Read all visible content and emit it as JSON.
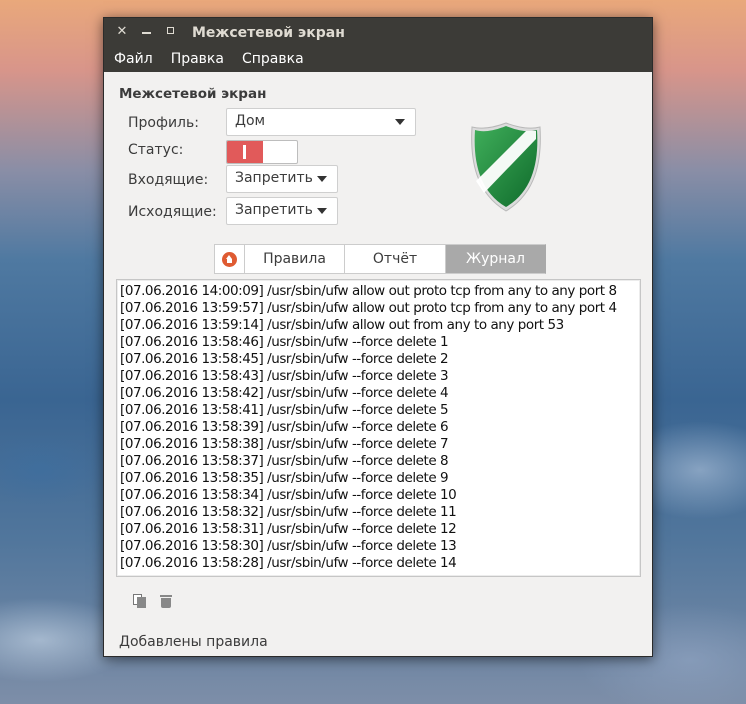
{
  "window": {
    "title": "Межсетевой экран"
  },
  "menu": [
    "Файл",
    "Правка",
    "Справка"
  ],
  "section_title": "Межсетевой экран",
  "form": {
    "profile_label": "Профиль:",
    "profile_value": "Дом",
    "status_label": "Статус:",
    "status_on": true,
    "incoming_label": "Входящие:",
    "incoming_value": "Запретить",
    "outgoing_label": "Исходящие:",
    "outgoing_value": "Запретить"
  },
  "colors": {
    "toggle_on": "#e15a5a",
    "active_tab": "#a9a9a9",
    "home_icon": "#df5b32",
    "shield_green": "#1f8a3a"
  },
  "tabs": {
    "home_icon": "home-icon",
    "rules": "Правила",
    "report": "Отчёт",
    "log": "Журнал",
    "active": "log"
  },
  "log_lines": [
    "[07.06.2016 14:00:09] /usr/sbin/ufw allow out proto tcp from any to any port 8",
    "[07.06.2016 13:59:57] /usr/sbin/ufw allow out proto tcp from any to any port 4",
    "[07.06.2016 13:59:14] /usr/sbin/ufw allow out from any to any port 53",
    "[07.06.2016 13:58:46] /usr/sbin/ufw --force delete 1",
    "[07.06.2016 13:58:45] /usr/sbin/ufw --force delete 2",
    "[07.06.2016 13:58:43] /usr/sbin/ufw --force delete 3",
    "[07.06.2016 13:58:42] /usr/sbin/ufw --force delete 4",
    "[07.06.2016 13:58:41] /usr/sbin/ufw --force delete 5",
    "[07.06.2016 13:58:39] /usr/sbin/ufw --force delete 6",
    "[07.06.2016 13:58:38] /usr/sbin/ufw --force delete 7",
    "[07.06.2016 13:58:37] /usr/sbin/ufw --force delete 8",
    "[07.06.2016 13:58:35] /usr/sbin/ufw --force delete 9",
    "[07.06.2016 13:58:34] /usr/sbin/ufw --force delete 10",
    "[07.06.2016 13:58:32] /usr/sbin/ufw --force delete 11",
    "[07.06.2016 13:58:31] /usr/sbin/ufw --force delete 12",
    "[07.06.2016 13:58:30] /usr/sbin/ufw --force delete 13",
    "[07.06.2016 13:58:28] /usr/sbin/ufw --force delete 14"
  ],
  "bottom_icons": [
    "copy-icon",
    "trash-icon"
  ],
  "status_text": "Добавлены правила"
}
